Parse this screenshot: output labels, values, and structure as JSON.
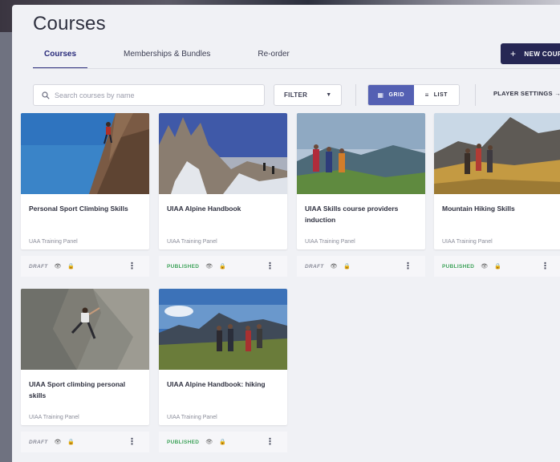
{
  "page_title": "Courses",
  "tabs": [
    {
      "label": "Courses",
      "active": true
    },
    {
      "label": "Memberships & Bundles",
      "active": false
    },
    {
      "label": "Re-order",
      "active": false
    }
  ],
  "new_course_button": {
    "plus": "+",
    "label": "NEW COURSE"
  },
  "search": {
    "placeholder": "Search courses by name"
  },
  "filter": {
    "label": "FILTER",
    "caret": "▼"
  },
  "view_toggle": {
    "grid": {
      "label": "GRID",
      "icon": "grid-icon",
      "active": true
    },
    "list": {
      "label": "LIST",
      "icon": "list-icon",
      "active": false
    }
  },
  "player_settings": {
    "label": "PLAYER SETTINGS",
    "arrow": "→"
  },
  "colors": {
    "primary_dark": "#262754",
    "accent": "#5460b3",
    "published": "#3fa35b",
    "draft": "#8a8c99",
    "background": "#f0f1f5"
  },
  "courses": [
    {
      "title": "Personal Sport Climbing Skills",
      "author": "UAA Training Panel",
      "status": "DRAFT",
      "image": "climber-on-rock-face"
    },
    {
      "title": "UIAA Alpine Handbook",
      "author": "UIAA Training Panel",
      "status": "PUBLISHED",
      "image": "rocky-alpine-peaks"
    },
    {
      "title": "UIAA Skills course providers induction",
      "author": "UIAA Training Panel",
      "status": "DRAFT",
      "image": "hikers-on-hill"
    },
    {
      "title": "Mountain Hiking Skills",
      "author": "UIAA Training Panel",
      "status": "PUBLISHED",
      "image": "mountain-hikers"
    },
    {
      "title": "UIAA Sport climbing personal skills",
      "author": "UIAA Training Panel",
      "status": "DRAFT",
      "image": "climber-on-wall"
    },
    {
      "title": "UIAA Alpine Handbook: hiking",
      "author": "UIAA Training Panel",
      "status": "PUBLISHED",
      "image": "hiking-group"
    }
  ]
}
